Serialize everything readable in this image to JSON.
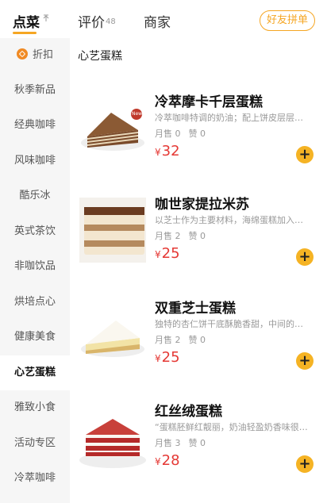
{
  "tabs": {
    "order": "点菜",
    "reviews": "评价",
    "reviews_count": "48",
    "merchant": "商家",
    "group_order": "好友拼单"
  },
  "sidebar": {
    "items": [
      {
        "label": "折扣"
      },
      {
        "label": "秋季新品"
      },
      {
        "label": "经典咖啡"
      },
      {
        "label": "风味咖啡"
      },
      {
        "label": "酷乐冰"
      },
      {
        "label": "英式茶饮"
      },
      {
        "label": "非咖饮品"
      },
      {
        "label": "烘培点心"
      },
      {
        "label": "健康美食"
      },
      {
        "label": "心艺蛋糕"
      },
      {
        "label": "雅致小食"
      },
      {
        "label": "活动专区"
      },
      {
        "label": "冷萃咖啡"
      }
    ],
    "active": "心艺蛋糕"
  },
  "category": {
    "title": "心艺蛋糕"
  },
  "products": [
    {
      "name": "冷萃摩卡千层蛋糕",
      "desc": "冷萃咖啡特调的奶油；配上饼皮层层…",
      "sold": "月售 0",
      "likes": "赞 0",
      "currency": "¥",
      "price": "32",
      "badge": "New"
    },
    {
      "name": "咖世家提拉米苏",
      "desc": "以芝士作为主要材料，海绵蛋糕加入…",
      "sold": "月售 2",
      "likes": "赞 0",
      "currency": "¥",
      "price": "25"
    },
    {
      "name": "双重芝士蛋糕",
      "desc": "独特的杏仁饼干底酥脆香甜，中间的…",
      "sold": "月售 2",
      "likes": "赞 0",
      "currency": "¥",
      "price": "25"
    },
    {
      "name": "红丝绒蛋糕",
      "desc": "“蛋糕胚鲜红靓丽，奶油轻盈奶香味很…",
      "sold": "月售 3",
      "likes": "赞 0",
      "currency": "¥",
      "price": "28"
    }
  ],
  "add_label": "+",
  "colors": {
    "accent": "#F5A623",
    "price": "#E53935",
    "add_button": "#F5B324"
  }
}
